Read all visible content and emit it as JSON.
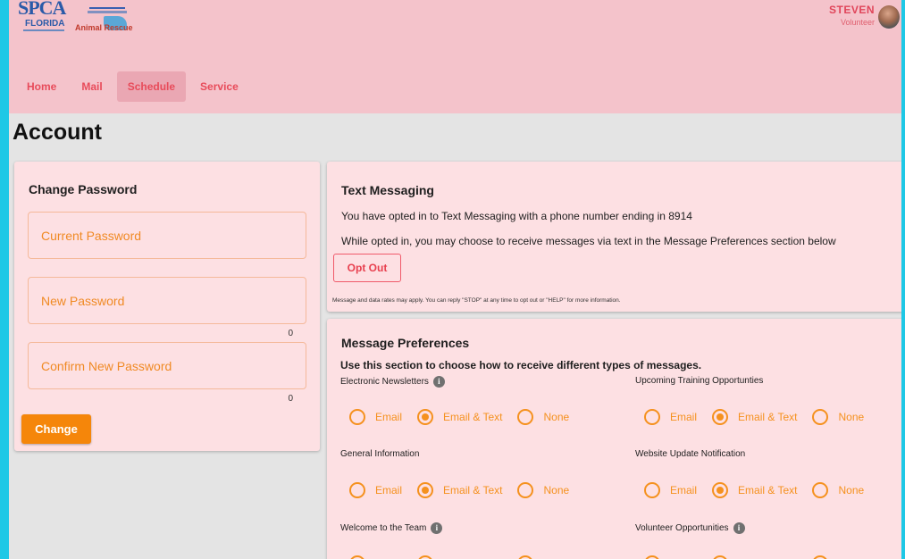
{
  "brand": {
    "spca_logo": "SPCA",
    "spca_region": "FLORIDA",
    "partner_logo_text": "Animal Rescue"
  },
  "user": {
    "name": "STEVEN",
    "role": "Volunteer"
  },
  "nav": {
    "items": [
      {
        "label": "Home",
        "active": false
      },
      {
        "label": "Mail",
        "active": false
      },
      {
        "label": "Schedule",
        "active": true
      },
      {
        "label": "Service",
        "active": false
      }
    ]
  },
  "page": {
    "title": "Account"
  },
  "change_password": {
    "title": "Change Password",
    "current_label": "Current Password",
    "new_label": "New Password",
    "new_count": "0",
    "confirm_label": "Confirm New Password",
    "confirm_count": "0",
    "button": "Change"
  },
  "text_messaging": {
    "title": "Text Messaging",
    "status": "You have opted in to Text Messaging with a phone number ending in 8914",
    "note": "While opted in, you may choose to receive messages via text in the Message Preferences section below",
    "opt_out_button": "Opt Out",
    "fine_print": "Message and data rates may apply. You can reply \"STOP\" at any time to opt out or \"HELP\" for more information."
  },
  "message_preferences": {
    "title": "Message Preferences",
    "subtitle": "Use this section to choose how to receive different types of messages.",
    "options": [
      "Email",
      "Email & Text",
      "None"
    ],
    "items": [
      {
        "label": "Electronic Newsletters",
        "info": true,
        "selected": "Email & Text"
      },
      {
        "label": "Upcoming Training Opportunties",
        "info": false,
        "selected": "Email & Text"
      },
      {
        "label": "General Information",
        "info": false,
        "selected": "Email & Text"
      },
      {
        "label": "Website Update Notification",
        "info": false,
        "selected": "Email & Text"
      },
      {
        "label": "Welcome to the Team",
        "info": true,
        "selected": "Email & Text"
      },
      {
        "label": "Volunteer Opportunities",
        "info": true,
        "selected": "Email & Text"
      }
    ]
  },
  "colors": {
    "header_bg": "#f4c3cb",
    "card_bg": "#fde0e3",
    "accent_orange": "#f5860a",
    "nav_text": "#e84b5a",
    "frame": "#1ec8e6"
  }
}
